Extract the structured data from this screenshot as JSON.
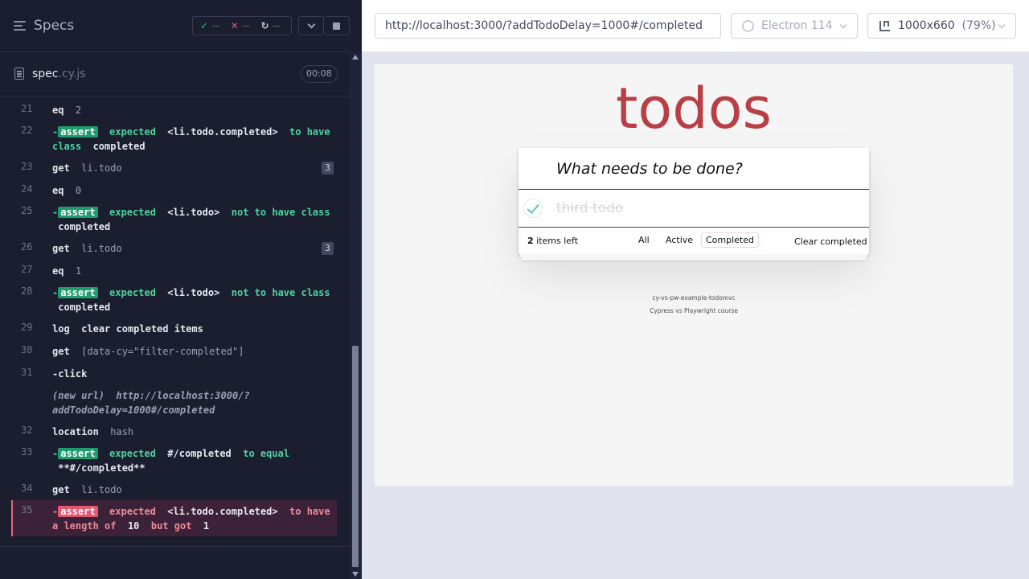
{
  "reporter": {
    "title": "Specs",
    "stats": {
      "passed": "--",
      "failed": "--",
      "pending": "--"
    },
    "spec": {
      "name": "spec",
      "ext": ".cy.js",
      "duration": "00:08"
    }
  },
  "commands": [
    {
      "num": "21",
      "name": "eq",
      "arg": "2"
    },
    {
      "num": "22",
      "prefix": "-",
      "tag": "assert",
      "t1": "expected",
      "v1": "<li.todo.completed>",
      "t2": "to have",
      "t3": "class",
      "v2": "completed"
    },
    {
      "num": "23",
      "name": "get",
      "arg": "li.todo",
      "badge": "3"
    },
    {
      "num": "24",
      "name": "eq",
      "arg": "0"
    },
    {
      "num": "25",
      "prefix": "-",
      "tag": "assert",
      "t1": "expected",
      "v1": "<li.todo>",
      "t2": "not to have class",
      "v2": "completed"
    },
    {
      "num": "26",
      "name": "get",
      "arg": "li.todo",
      "badge": "3"
    },
    {
      "num": "27",
      "name": "eq",
      "arg": "1"
    },
    {
      "num": "28",
      "prefix": "-",
      "tag": "assert",
      "t1": "expected",
      "v1": "<li.todo>",
      "t2": "not to have class",
      "v2": "completed"
    },
    {
      "num": "29",
      "name": "log",
      "msg": "clear completed items"
    },
    {
      "num": "30",
      "name": "get",
      "arg": "[data-cy=\"filter-completed\"]"
    },
    {
      "num": "31",
      "name": "-click"
    },
    {
      "newurl_label": "(new url)",
      "newurl_1": "http://localhost:3000/?",
      "newurl_2": "addTodoDelay=1000#/completed"
    },
    {
      "num": "32",
      "name": "location",
      "arg": "hash"
    },
    {
      "num": "33",
      "prefix": "-",
      "tag": "assert",
      "t1": "expected",
      "v1": "#/completed",
      "t2": "to equal",
      "v2": "**#/completed**"
    },
    {
      "num": "34",
      "name": "get",
      "arg": "li.todo"
    },
    {
      "num": "35",
      "prefix": "-",
      "tag": "assert",
      "t1": "expected",
      "v1": "<li.todo.completed>",
      "t2": "to have",
      "t3": "a length of",
      "v2": "10",
      "t4": "but got",
      "v3": "1"
    }
  ],
  "toolbar": {
    "url": "http://localhost:3000/?addTodoDelay=1000#/completed",
    "browser": "Electron 114",
    "viewport": "1000x660",
    "zoom": "(79%)"
  },
  "app": {
    "title": "todos",
    "placeholder": "What needs to be done?",
    "todo": "third todo",
    "count": "2",
    "count_label": "items left",
    "filters": [
      "All",
      "Active",
      "Completed"
    ],
    "clear": "Clear completed",
    "info1": "cy-vs-pw-example-todomvc",
    "info2": "Cypress vs Playwright course"
  },
  "colors": {
    "reporter_bg": "#1b1e2e",
    "pass": "#4fd1a0",
    "fail": "#e45770",
    "todo_title": "#b83f45"
  }
}
